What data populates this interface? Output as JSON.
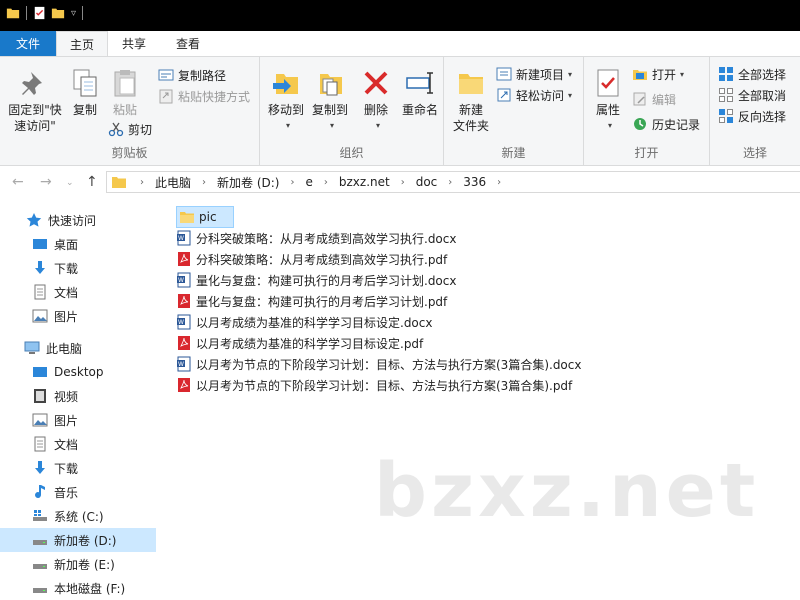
{
  "ribbon_tabs": {
    "file": "文件",
    "home": "主页",
    "share": "共享",
    "view": "查看"
  },
  "clipboard": {
    "pin_line1": "固定到\"快",
    "pin_line2": "速访问\"",
    "copy": "复制",
    "paste": "粘贴",
    "copy_path": "复制路径",
    "paste_shortcut": "粘贴快捷方式",
    "cut": "剪切",
    "group_label": "剪贴板"
  },
  "organize": {
    "move_to": "移动到",
    "copy_to": "复制到",
    "delete": "删除",
    "rename": "重命名",
    "group_label": "组织"
  },
  "new_group": {
    "new_folder_line1": "新建",
    "new_folder_line2": "文件夹",
    "new_item": "新建项目",
    "easy_access": "轻松访问",
    "group_label": "新建"
  },
  "open_group": {
    "properties": "属性",
    "open": "打开",
    "edit": "编辑",
    "history": "历史记录",
    "group_label": "打开"
  },
  "select_group": {
    "select_all": "全部选择",
    "select_none": "全部取消",
    "invert": "反向选择",
    "group_label": "选择"
  },
  "breadcrumbs": [
    "此电脑",
    "新加卷 (D:)",
    "e",
    "bzxz.net",
    "doc",
    "336"
  ],
  "sidebar": {
    "quick_access": "快速访问",
    "qa_items": [
      "桌面",
      "下载",
      "文档",
      "图片"
    ],
    "this_pc": "此电脑",
    "pc_items": [
      "Desktop",
      "视频",
      "图片",
      "文档",
      "下载",
      "音乐",
      "系统 (C:)",
      "新加卷 (D:)",
      "新加卷 (E:)",
      "本地磁盘 (F:)"
    ]
  },
  "files": [
    {
      "name": "pic",
      "type": "folder"
    },
    {
      "name": "分科突破策略：从月考成绩到高效学习执行.docx",
      "type": "docx"
    },
    {
      "name": "分科突破策略：从月考成绩到高效学习执行.pdf",
      "type": "pdf"
    },
    {
      "name": "量化与复盘：构建可执行的月考后学习计划.docx",
      "type": "docx"
    },
    {
      "name": "量化与复盘：构建可执行的月考后学习计划.pdf",
      "type": "pdf"
    },
    {
      "name": "以月考成绩为基准的科学学习目标设定.docx",
      "type": "docx"
    },
    {
      "name": "以月考成绩为基准的科学学习目标设定.pdf",
      "type": "pdf"
    },
    {
      "name": "以月考为节点的下阶段学习计划：目标、方法与执行方案(3篇合集).docx",
      "type": "docx"
    },
    {
      "name": "以月考为节点的下阶段学习计划：目标、方法与执行方案(3篇合集).pdf",
      "type": "pdf"
    }
  ],
  "watermark": "bzxz.net",
  "colors": {
    "accent": "#1979ca",
    "selection": "#cce8ff",
    "folder": "#f5c84c",
    "pdf": "#d9272e",
    "word": "#2b5797"
  }
}
